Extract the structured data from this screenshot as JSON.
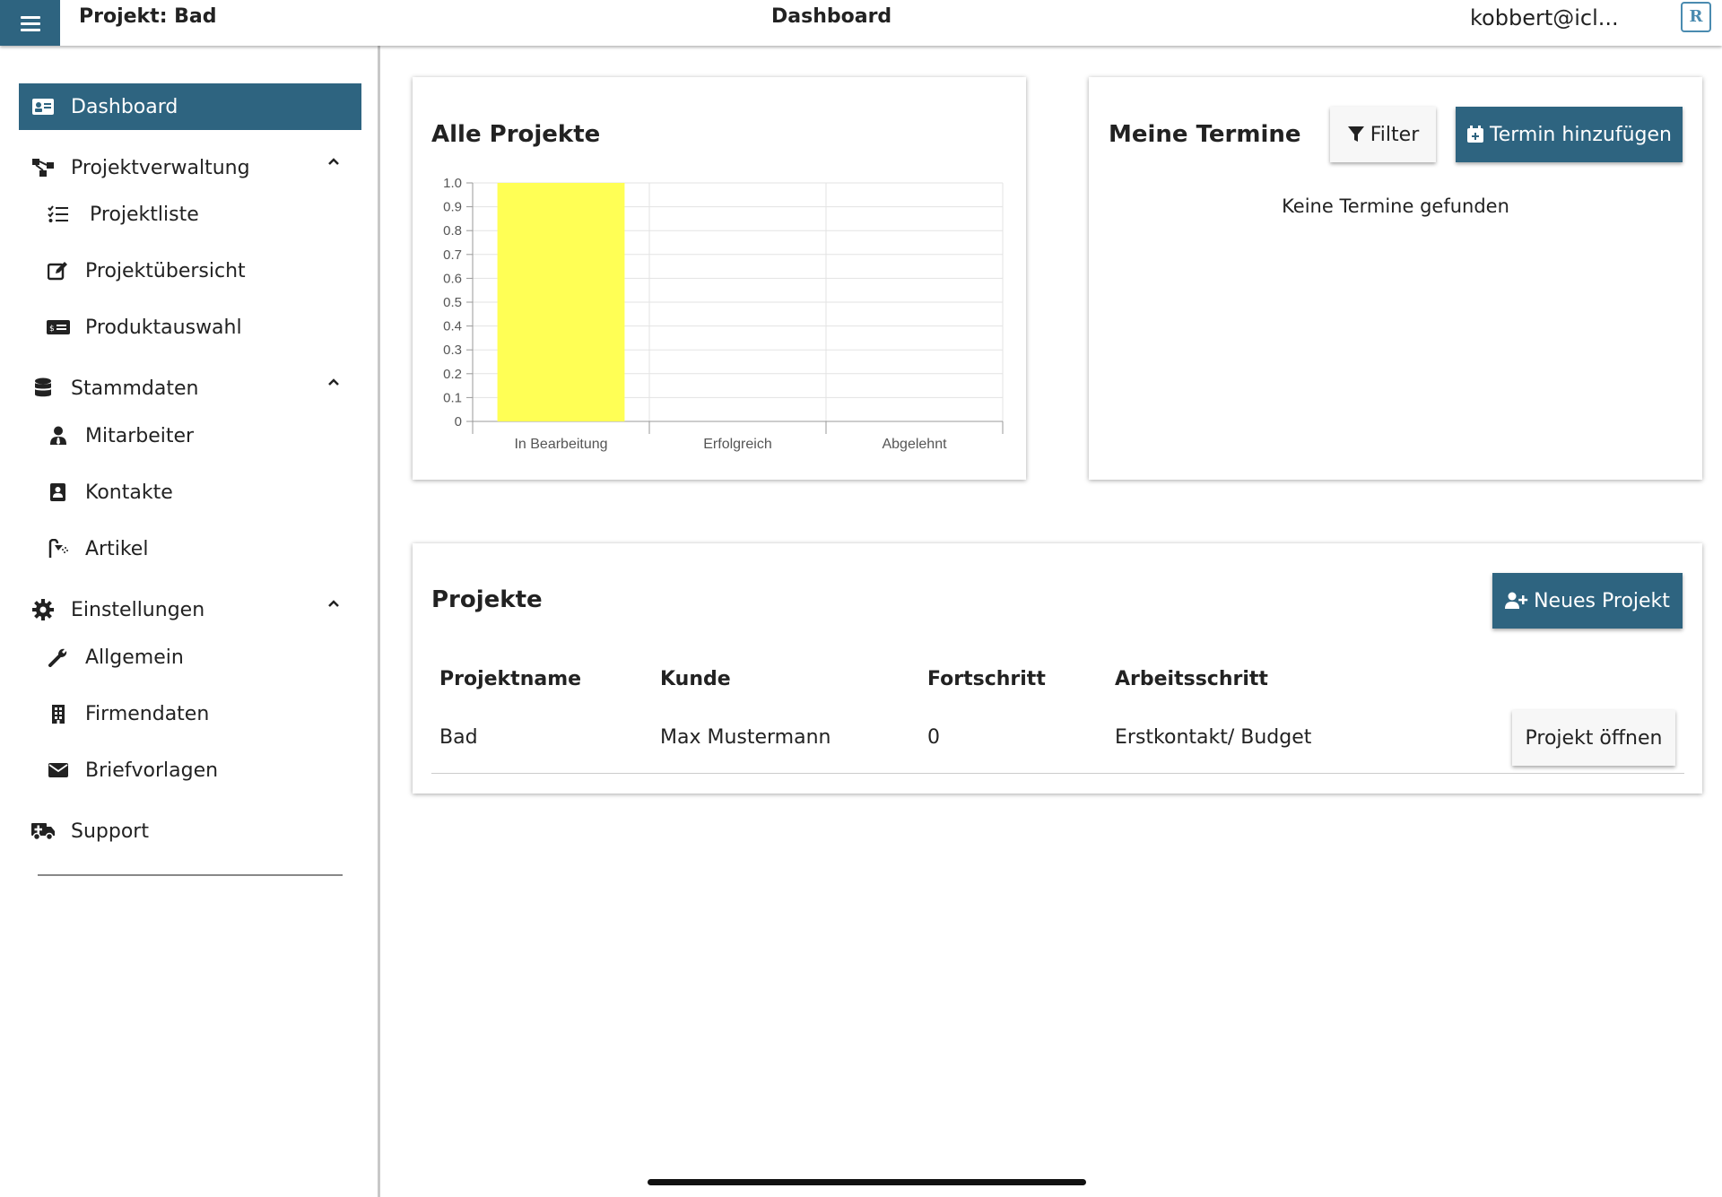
{
  "header": {
    "project_title": "Projekt: Bad",
    "page_title": "Dashboard",
    "user_email": "kobbert@icl..."
  },
  "sidebar": {
    "dashboard": "Dashboard",
    "projektverwaltung": {
      "label": "Projektverwaltung",
      "items": [
        "Projektliste",
        "Projektübersicht",
        "Produktauswahl"
      ]
    },
    "stammdaten": {
      "label": "Stammdaten",
      "items": [
        "Mitarbeiter",
        "Kontakte",
        "Artikel"
      ]
    },
    "einstellungen": {
      "label": "Einstellungen",
      "items": [
        "Allgemein",
        "Firmendaten",
        "Briefvorlagen"
      ]
    },
    "support": "Support"
  },
  "projects_chart": {
    "title": "Alle Projekte"
  },
  "chart_data": {
    "type": "bar",
    "title": "",
    "xlabel": "",
    "ylabel": "",
    "categories": [
      "In Bearbeitung",
      "Erfolgreich",
      "Abgelehnt"
    ],
    "values": [
      1,
      0,
      0
    ],
    "ylim": [
      0,
      1.0
    ],
    "yticks": [
      "0",
      "0.1",
      "0.2",
      "0.3",
      "0.4",
      "0.5",
      "0.6",
      "0.7",
      "0.8",
      "0.9",
      "1.0"
    ],
    "bar_color": "#ffff55",
    "grid": true
  },
  "appointments": {
    "title": "Meine Termine",
    "filter_label": "Filter",
    "add_label": "Termin hinzufügen",
    "empty_text": "Keine Termine gefunden"
  },
  "projects_table": {
    "title": "Projekte",
    "new_label": "Neues Projekt",
    "columns": [
      "Projektname",
      "Kunde",
      "Fortschritt",
      "Arbeitsschritt"
    ],
    "rows": [
      {
        "name": "Bad",
        "customer": "Max Mustermann",
        "progress": "0",
        "step": "Erstkontakt/ Budget",
        "action": "Projekt öffnen"
      }
    ]
  },
  "colors": {
    "primary": "#2e6480",
    "bar": "#ffff55"
  }
}
